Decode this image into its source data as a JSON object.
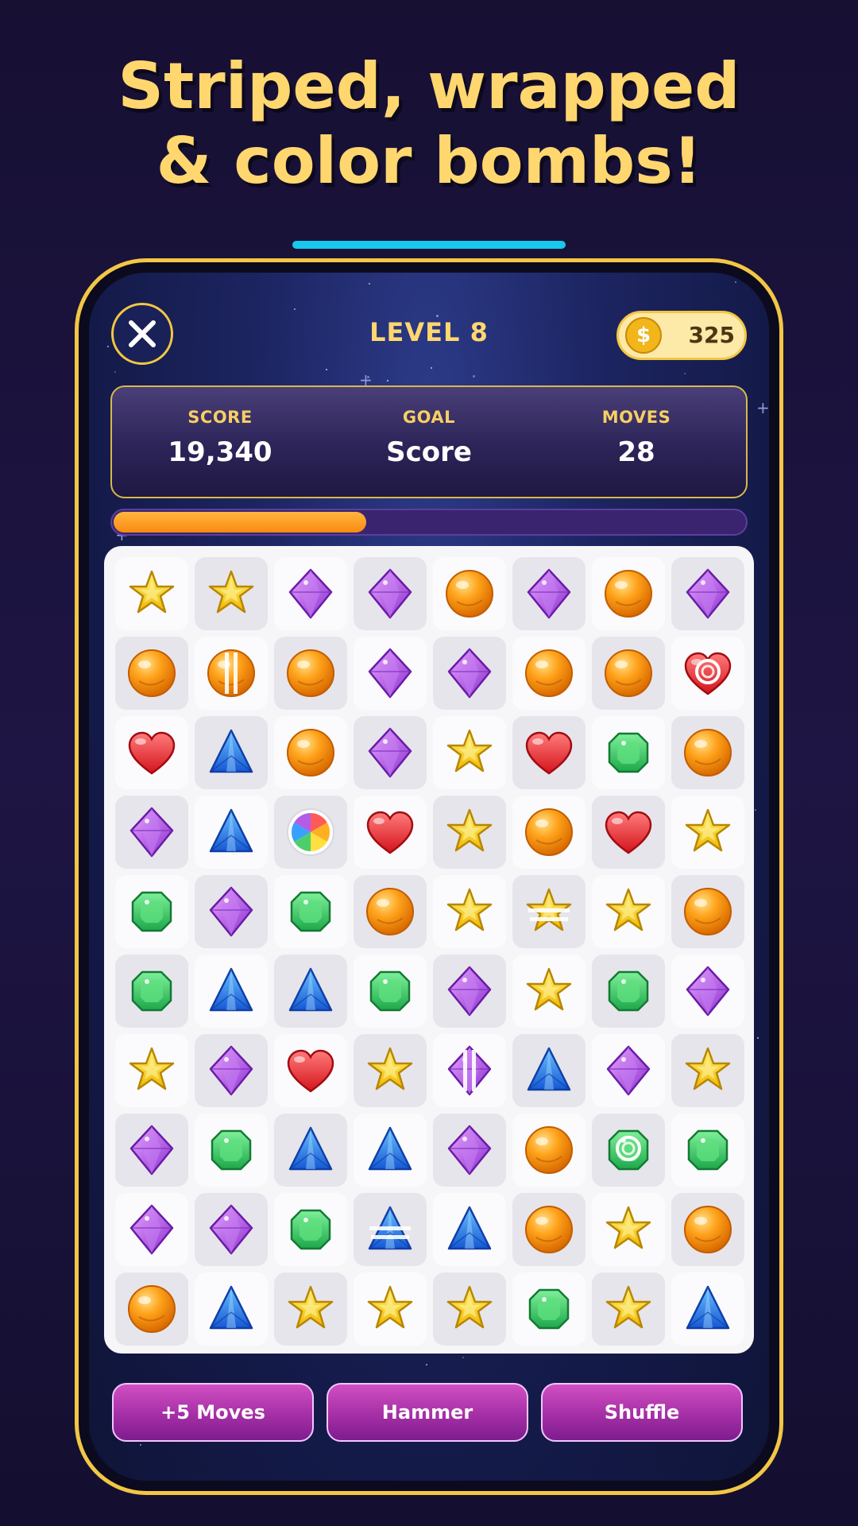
{
  "headline": {
    "line1": "Striped, wrapped",
    "line2": "& color bombs!"
  },
  "colors": {
    "accent": "#18c8ee",
    "gold": "#f2c744",
    "headline": "#ffd76e",
    "booster": "#b43ab3"
  },
  "header": {
    "close_icon": "close-icon",
    "level": "LEVEL 8",
    "coins": "325",
    "coin_symbol": "$"
  },
  "stats": {
    "score_label": "SCORE",
    "score_value": "19,340",
    "goal_label": "GOAL",
    "goal_value": "Score",
    "moves_label": "MOVES",
    "moves_value": "28"
  },
  "progress": {
    "fraction": 0.4
  },
  "board": {
    "rows": 10,
    "cols": 8,
    "pattern": [
      [
        "L",
        "D",
        "L",
        "D",
        "L",
        "D",
        "L",
        "D"
      ],
      [
        "D",
        "L",
        "D",
        "L",
        "D",
        "L",
        "D",
        "L"
      ],
      [
        "L",
        "D",
        "L",
        "D",
        "L",
        "D",
        "L",
        "D"
      ],
      [
        "D",
        "L",
        "D",
        "L",
        "D",
        "L",
        "D",
        "L"
      ],
      [
        "L",
        "D",
        "L",
        "D",
        "L",
        "D",
        "L",
        "D"
      ],
      [
        "D",
        "L",
        "D",
        "L",
        "D",
        "L",
        "D",
        "L"
      ],
      [
        "L",
        "D",
        "L",
        "D",
        "L",
        "D",
        "L",
        "D"
      ],
      [
        "D",
        "L",
        "D",
        "L",
        "D",
        "L",
        "D",
        "L"
      ],
      [
        "L",
        "D",
        "L",
        "D",
        "L",
        "D",
        "L",
        "D"
      ],
      [
        "D",
        "L",
        "D",
        "L",
        "D",
        "L",
        "D",
        "L"
      ]
    ],
    "grid": [
      [
        "star",
        "star",
        "diamond",
        "diamond",
        "orb",
        "diamond",
        "orb",
        "diamond"
      ],
      [
        "orb",
        "orb-striped-v",
        "orb",
        "diamond",
        "diamond",
        "orb",
        "orb",
        "heart-wrapped"
      ],
      [
        "heart",
        "triangle",
        "orb",
        "diamond",
        "star",
        "heart",
        "emerald",
        "orb"
      ],
      [
        "diamond",
        "triangle",
        "color-bomb",
        "heart",
        "star",
        "orb",
        "heart",
        "star"
      ],
      [
        "emerald",
        "diamond",
        "emerald",
        "orb",
        "star",
        "star-striped-h",
        "star",
        "orb"
      ],
      [
        "emerald",
        "triangle",
        "triangle",
        "emerald",
        "diamond",
        "star",
        "emerald",
        "diamond"
      ],
      [
        "star",
        "diamond",
        "heart",
        "star",
        "diamond-striped-v",
        "triangle",
        "diamond",
        "star"
      ],
      [
        "diamond",
        "emerald",
        "triangle",
        "triangle",
        "diamond",
        "orb",
        "emerald-wrapped",
        "emerald"
      ],
      [
        "diamond",
        "diamond",
        "emerald",
        "triangle-striped-h",
        "triangle",
        "orb",
        "star",
        "orb"
      ],
      [
        "orb",
        "triangle",
        "star",
        "star",
        "star",
        "emerald",
        "star",
        "triangle"
      ]
    ]
  },
  "boosters": [
    {
      "label": "+5 Moves"
    },
    {
      "label": "Hammer"
    },
    {
      "label": "Shuffle"
    }
  ]
}
